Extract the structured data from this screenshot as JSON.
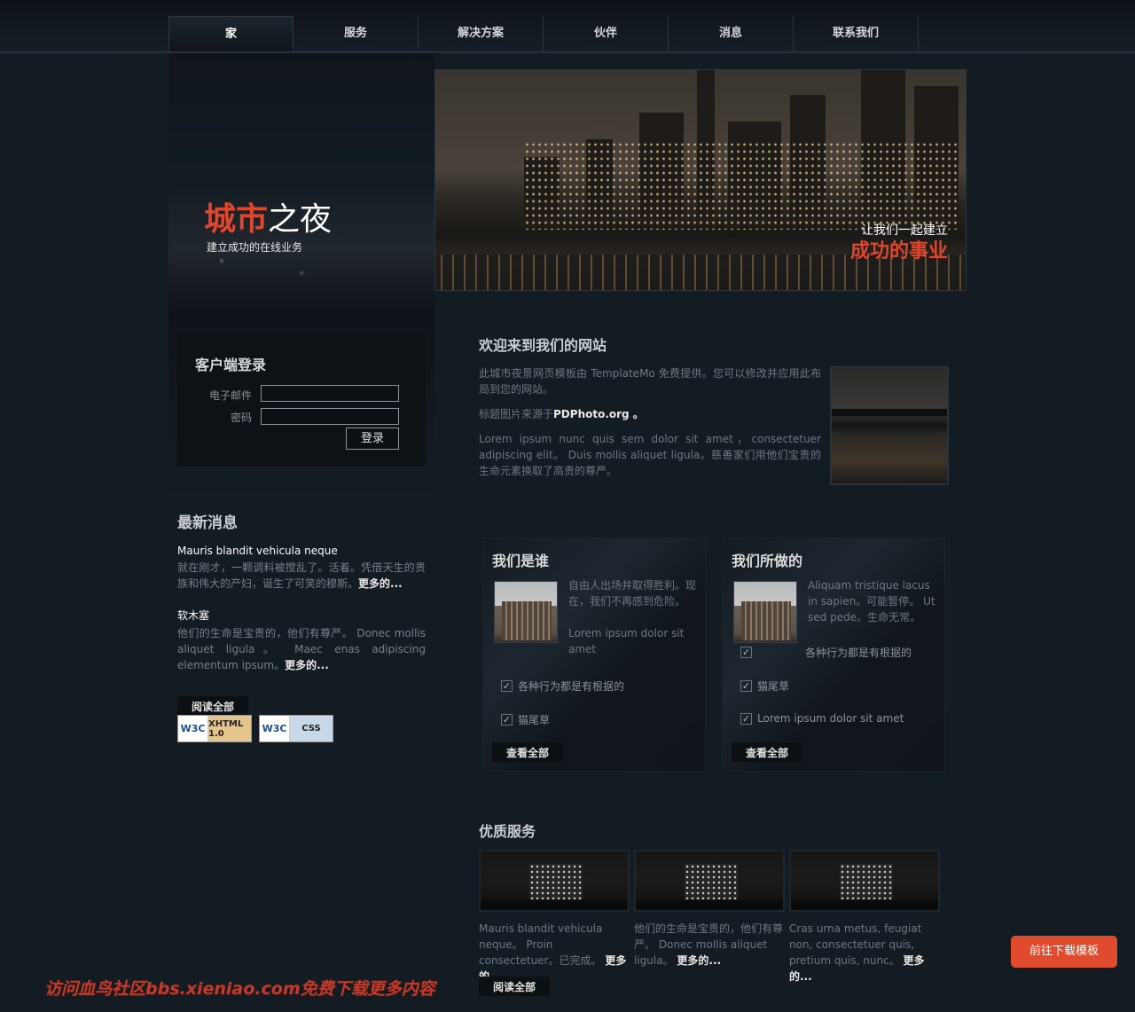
{
  "nav": {
    "items": [
      {
        "label": "家"
      },
      {
        "label": "服务"
      },
      {
        "label": "解决方案"
      },
      {
        "label": "伙伴"
      },
      {
        "label": "消息"
      },
      {
        "label": "联系我们"
      }
    ]
  },
  "brand": {
    "title_red": "城市",
    "title_white": "之夜",
    "tagline": "建立成功的在线业务"
  },
  "hero": {
    "line1": "让我们一起建立",
    "line2": "成功的事业"
  },
  "login": {
    "title": "客户端登录",
    "email_label": "电子邮件",
    "password_label": "密码",
    "button": "登录"
  },
  "news": {
    "title": "最新消息",
    "items": [
      {
        "title": "Mauris blandit vehicula neque",
        "body": "就在刚才，一颗调料被搅乱了。活着。凭借天生的贵族和伟大的产妇，诞生了可笑的穆斯。",
        "more": "更多的..."
      },
      {
        "title": "软木塞",
        "body": "他们的生命是宝贵的，他们有尊严。 Donec mollis aliquet ligula。 Maec enas adipiscing elementum ipsum。",
        "more": "更多的..."
      }
    ],
    "read_all": "阅读全部"
  },
  "badges": {
    "xhtml": "XHTML 1.0",
    "css": "CSS",
    "w3c": "W3C"
  },
  "welcome": {
    "title": "欢迎来到我们的网站",
    "p1": "此城市夜景网页模板由 TemplateMo 免费提供。您可以修改并应用此布局到您的网站。",
    "p2_prefix": "标题图片来源于",
    "p2_link": "PDPhoto.org 。",
    "p3": "Lorem ipsum nunc quis sem dolor sit amet，consectetuer adipiscing elit。 Duis mollis aliquet ligula。慈善家们用他们宝贵的生命元素换取了高贵的尊严。"
  },
  "who": {
    "title": "我们是谁",
    "text1": "自由人出场并取得胜利。现在，我们不再感到危险。",
    "text2": "Lorem ipsum dolor sit amet",
    "checks": [
      "各种行为都是有根据的",
      "猫尾草"
    ],
    "button": "查看全部"
  },
  "what": {
    "title": "我们所做的",
    "text1": "Aliquam tristique lacus in sapien。可能暂停。 Ut sed pede。生命无常。",
    "checks": [
      "各种行为都是有根据的",
      "猫尾草",
      "Lorem ipsum dolor sit amet"
    ],
    "button": "查看全部"
  },
  "quality": {
    "title": "优质服务",
    "items": [
      {
        "text": "Mauris blandit vehicula neque。 Proin consectetuer。已完成。",
        "more": "更多的..."
      },
      {
        "text": "他们的生命是宝贵的，他们有尊严。 Donec mollis aliquet ligula。",
        "more": "更多的..."
      },
      {
        "text": "Cras urna metus, feugiat non, consectetuer quis, pretium quis, nunc。",
        "more": "更多的..."
      }
    ],
    "read_all": "阅读全部"
  },
  "watermark": "访问血鸟社区bbs.xieniao.com免费下载更多内容",
  "download_button": "前往下载模板",
  "colors": {
    "accent": "#e0462b",
    "background": "#131b23"
  }
}
